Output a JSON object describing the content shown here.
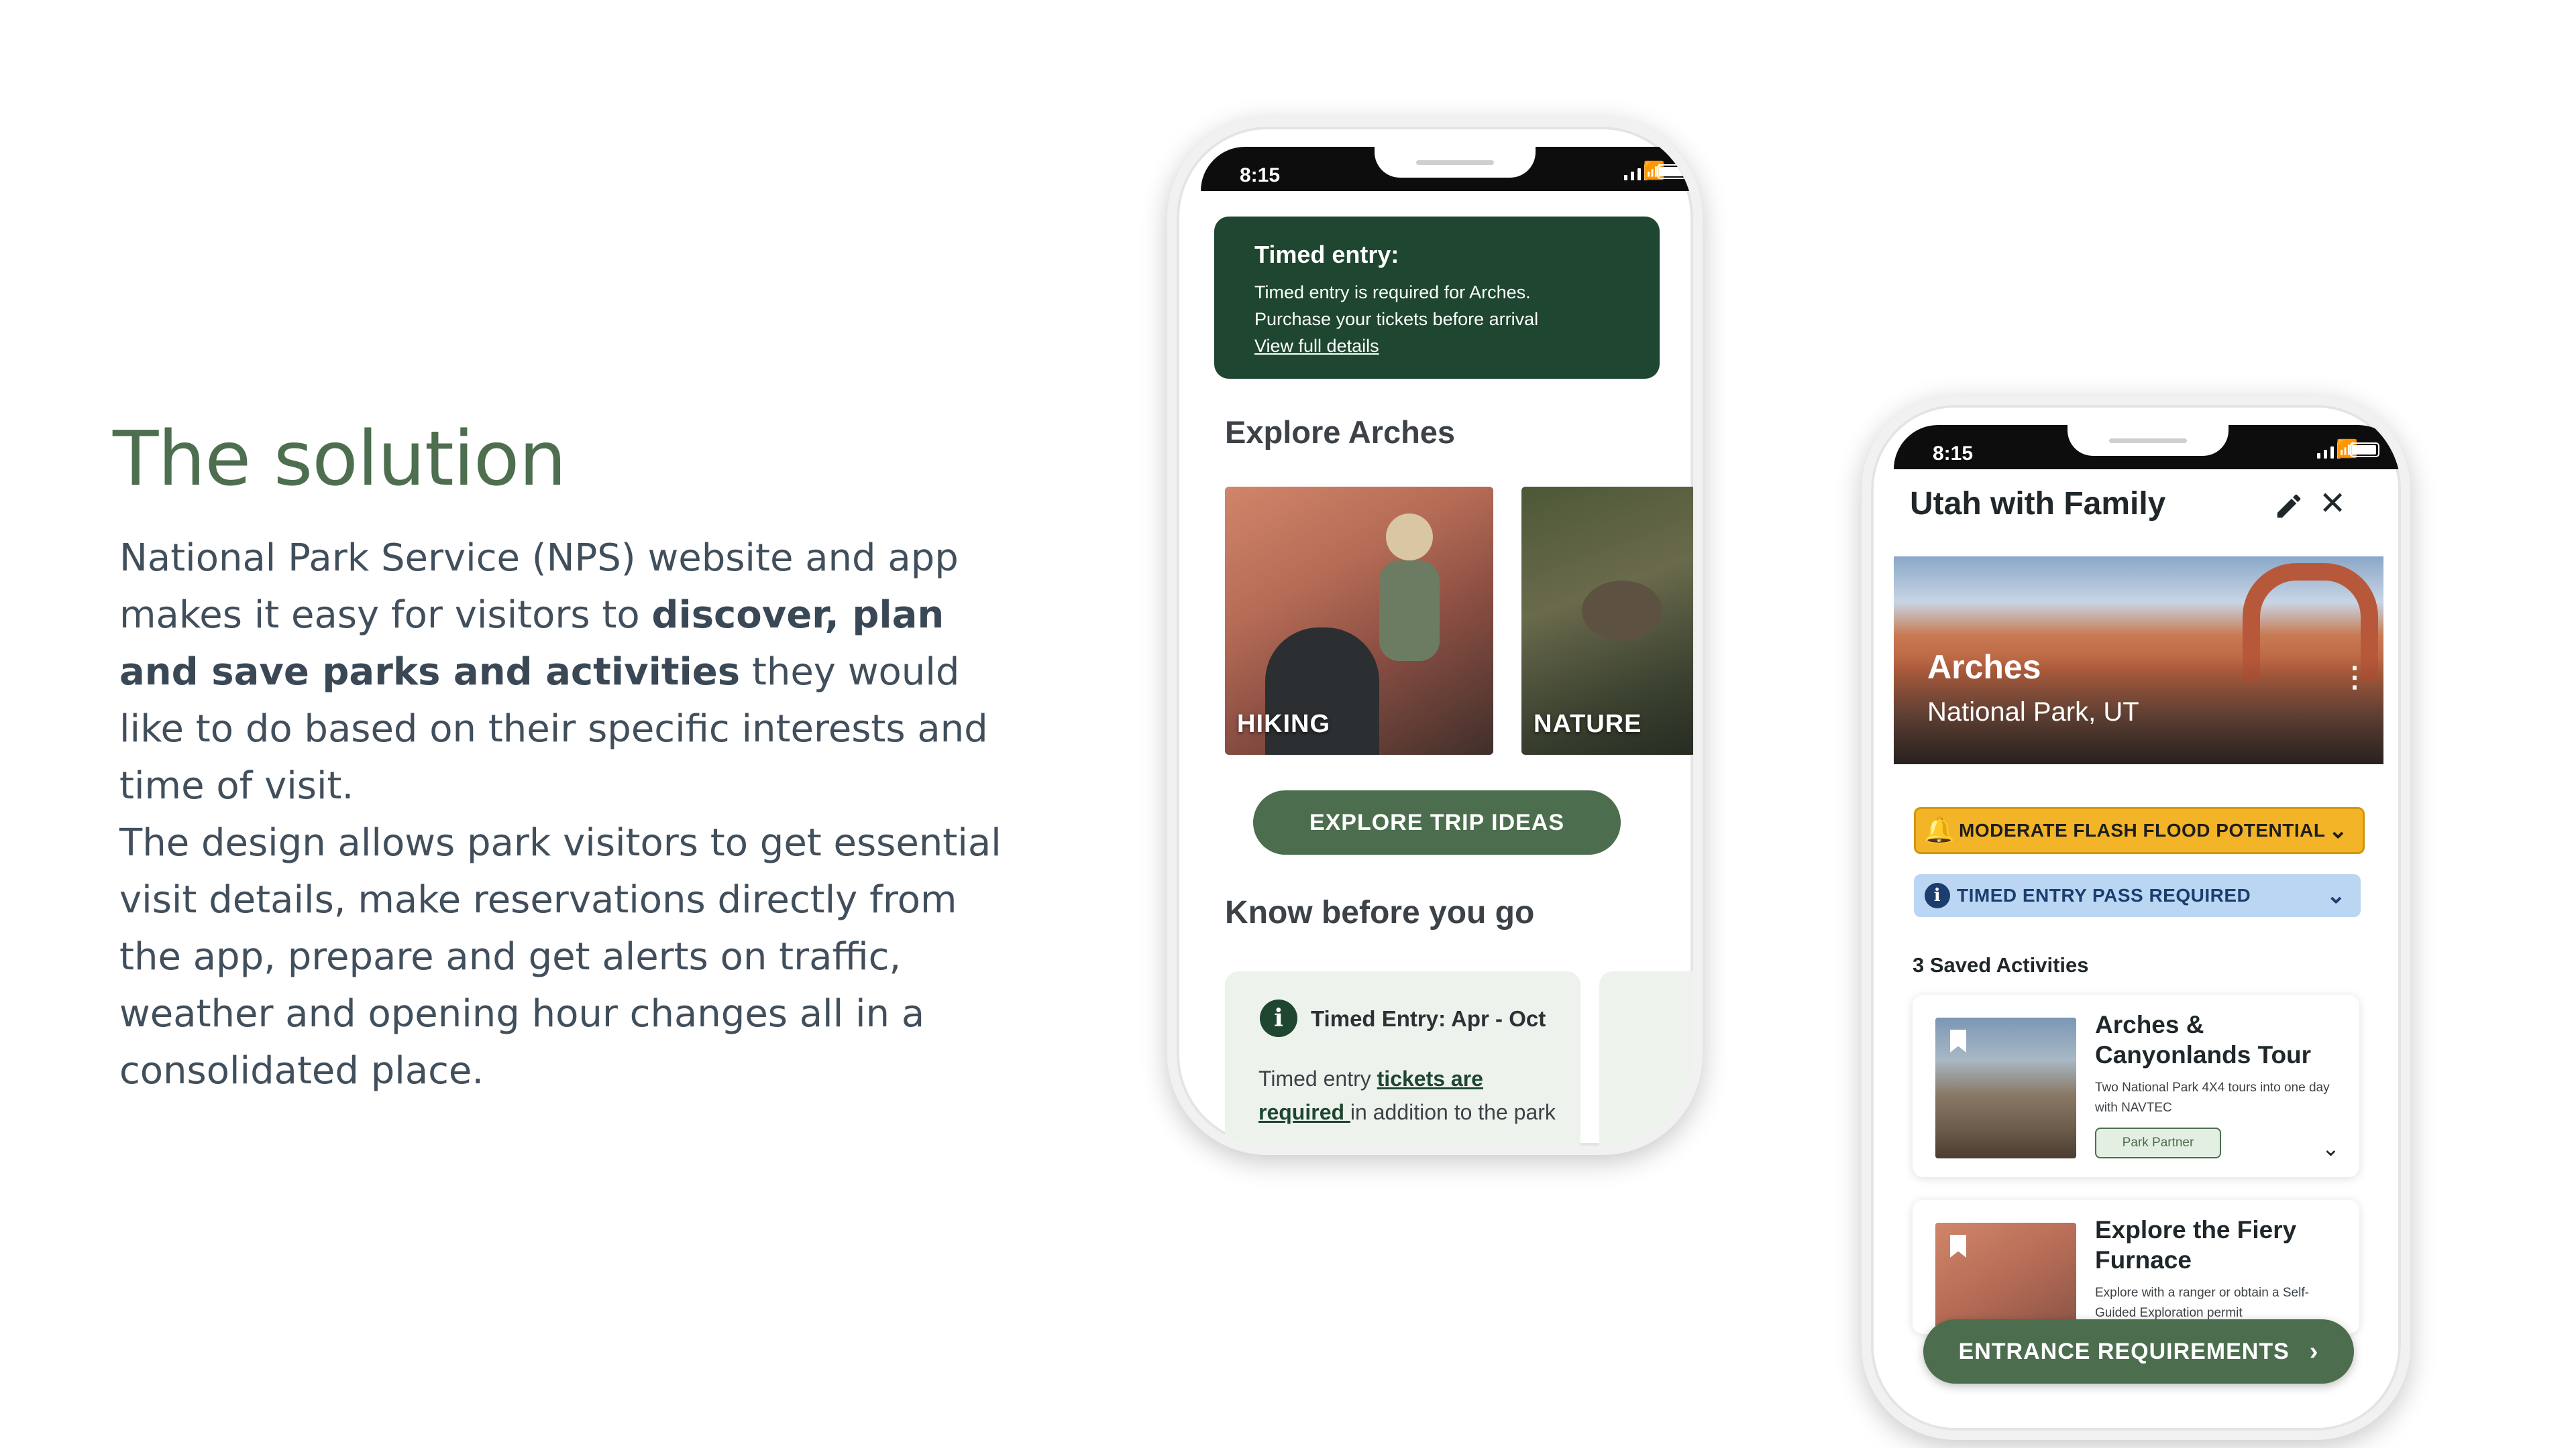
{
  "slide": {
    "title": "The solution",
    "para1": {
      "pre": "National Park Service (NPS) website and app makes it easy for visitors to ",
      "bold": "discover, plan and save parks and activities",
      "post": " they would like to do based on their specific interests and time of visit."
    },
    "para2": "The design allows park visitors to get essential visit details, make reservations directly from the app, prepare and get alerts on traffic, weather and opening hour changes all in a consolidated place."
  },
  "phone1": {
    "time": "8:15",
    "alert": {
      "title": "Timed entry:",
      "line1": "Timed entry is required for Arches.",
      "line2": "Purchase your tickets before arrival",
      "link": "View full details"
    },
    "explore_heading": "Explore Arches",
    "tiles": [
      {
        "label": "HIKING"
      },
      {
        "label": "NATURE"
      }
    ],
    "explore_button": "EXPLORE TRIP IDEAS",
    "know_heading": "Know before you go",
    "know_card": {
      "title": "Timed Entry: Apr - Oct",
      "text_pre": "Timed entry ",
      "text_link": "tickets are required ",
      "text_post": "in addition to the park"
    }
  },
  "phone2": {
    "time": "8:15",
    "trip_title": "Utah with Family",
    "park_name": "Arches",
    "park_sub": "National Park, UT",
    "banners": {
      "flood": "MODERATE FLASH FLOOD POTENTIAL",
      "timed": "TIMED ENTRY PASS REQUIRED"
    },
    "saved_heading": "3 Saved Activities",
    "activities": [
      {
        "title": "Arches & Canyonlands Tour",
        "desc": "Two National Park 4X4 tours into one day with NAVTEC",
        "badge": "Park Partner"
      },
      {
        "title": "Explore the Fiery Furnace",
        "desc": "Explore with a ranger or obtain a Self-Guided Exploration permit"
      }
    ],
    "entrance_button": "ENTRANCE REQUIREMENTS"
  },
  "colors": {
    "accent_green": "#4c6e4e",
    "dark_green": "#1e4630",
    "flood_yellow": "#f3b428",
    "timed_blue": "#bad6f3",
    "text_slate": "#414f5c"
  },
  "icons": [
    "signal-icon",
    "wifi-icon",
    "battery-icon",
    "info-icon",
    "pencil-icon",
    "close-icon",
    "bell-alert-icon",
    "chevron-down-icon",
    "bookmark-icon",
    "chevron-right-icon",
    "more-vertical-icon"
  ]
}
